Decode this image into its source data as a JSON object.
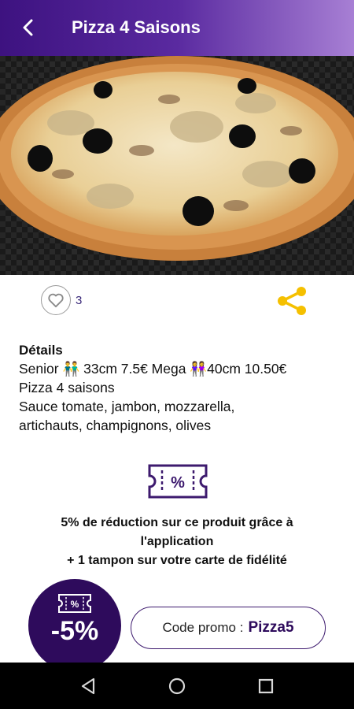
{
  "appbar": {
    "title": "Pizza 4 Saisons",
    "color_start": "#3d1280",
    "color_end": "#a77fd4"
  },
  "photo": {
    "icon": "pizza-photo"
  },
  "likes": {
    "count": "3",
    "icon": "heart-outline-icon"
  },
  "share": {
    "icon": "share-icon",
    "color": "#f5c000"
  },
  "details": {
    "heading": "Détails",
    "line1": "Senior 👬 33cm 7.5€ Mega 👭40cm 10.50€",
    "line2": "Pizza 4 saisons",
    "line3": "Sauce tomate, jambon, mozzarella,",
    "line4": "artichauts, champignons, olives"
  },
  "promo": {
    "line1": "5% de réduction sur ce produit grâce à",
    "line2": "l'application",
    "line3": "+ 1 tampon sur votre carte de fidélité",
    "badge": "-5%",
    "code_label": "Code promo :",
    "code": "Pizza5"
  },
  "navbar": {
    "icons": [
      "back-triangle-icon",
      "home-circle-icon",
      "recents-square-icon"
    ]
  }
}
